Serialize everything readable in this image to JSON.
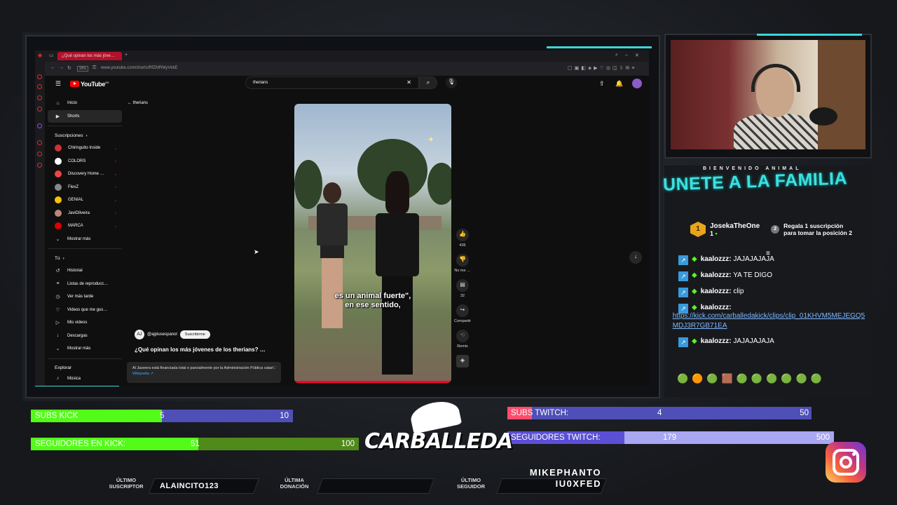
{
  "browser": {
    "tab_title": "¿Qué opinan los más jóve…",
    "zoom": "33%",
    "url": "www.youtube.com/shorts/RfZMRMyVkkE"
  },
  "youtube": {
    "logo": "YouTube",
    "logo_sup": "MX",
    "search_value": "therians",
    "back_label": "therians",
    "nav_main": [
      {
        "icon": "home-icon",
        "glyph": "⌂",
        "label": "Inicio"
      },
      {
        "icon": "shorts-icon",
        "glyph": "▶",
        "label": "Shorts"
      }
    ],
    "subs_header": "Suscripciones",
    "subscriptions": [
      {
        "label": "Chiringuito Inside",
        "color": "#c33"
      },
      {
        "label": "COLORS",
        "color": "#fff"
      },
      {
        "label": "Discovery Home …",
        "color": "#e44"
      },
      {
        "label": "FlexZ",
        "color": "#888"
      },
      {
        "label": "GENIAL",
        "color": "#f4c20d"
      },
      {
        "label": "JaviOliveira",
        "color": "#b87"
      },
      {
        "label": "MARCA",
        "color": "#d00"
      }
    ],
    "show_more": "Mostrar más",
    "you_header": "Tú",
    "you_items": [
      {
        "glyph": "↺",
        "label": "Historial"
      },
      {
        "glyph": "≡",
        "label": "Listas de reproducc…"
      },
      {
        "glyph": "◷",
        "label": "Ver más tarde"
      },
      {
        "glyph": "♡",
        "label": "Videos que me gus…"
      },
      {
        "glyph": "▷",
        "label": "Mis videos"
      },
      {
        "glyph": "↓",
        "label": "Descargas"
      },
      {
        "glyph": "⌄",
        "label": "Mostrar más"
      }
    ],
    "explore_header": "Explorar",
    "explore_item": "Música",
    "short": {
      "caption_line1": "es un animal fuerte\",",
      "caption_line2": "en ese sentido,",
      "channel": "@ajplusespanol",
      "subscribe": "Suscribirme",
      "title": "¿Qué opinan los más jóvenes de los therians? …",
      "info_text": "Al Jazeera está financiada total o parcialmente por la Administración Pública catarí.",
      "info_link": "Wikipedia ↗",
      "likes": "436",
      "dislike": "No me …",
      "comments": "32",
      "share": "Compartir",
      "remix": "Remix"
    }
  },
  "overlay": {
    "welcome": "BIENVENIDO ANIMAL",
    "join": "UNETE A LA FAMILIA",
    "leader_name": "JosekaTheOne",
    "leader_count": "1",
    "gift_text": "Regala 1 suscripción para tomar la posición 2",
    "chat": [
      {
        "user": "kaalozzz:",
        "msg": "JAJAJAJAJA"
      },
      {
        "user": "kaalozzz:",
        "msg": "YA TE DIGO"
      },
      {
        "user": "kaalozzz:",
        "msg": "clip"
      },
      {
        "user": "kaalozzz:",
        "msg": "",
        "link": "https://kick.com/carballedakick/clips/clip_01KHVM5MEJEGQ5MDJ3R7GB71EA"
      },
      {
        "user": "kaalozzz:",
        "msg": "JAJAJAJAJA"
      }
    ],
    "emotes": "🟢🟠🟢🟫🟢🟢🟢🟢🟢🟢",
    "bars": {
      "subs_kick": {
        "label": "SUBS KICK",
        "current": "5",
        "goal": "10",
        "progress": 0.5
      },
      "seg_kick": {
        "label": "SEGUIDORES EN KICK:",
        "current": "51",
        "goal": "100",
        "progress": 0.51
      },
      "subs_twitch": {
        "label": "SUBS TWITCH:",
        "current": "4",
        "goal": "50",
        "progress": 0.08
      },
      "seg_twitch": {
        "label": "SEGUIDORES TWITCH:",
        "current": "179",
        "goal": "500",
        "progress": 0.358
      }
    },
    "logo_text": "CARBALLEDA",
    "last_sub_label": "ÚLTIMO SUSCRIPTOR",
    "last_sub": "ALAINCITO123",
    "last_don_label": "ÚLTIMA DONACIÓN",
    "last_don": "",
    "last_follow_label": "ÚLTIMO SEGUIDOR",
    "last_follow": "MIKEPHANTO IU0XFED"
  },
  "colors": {
    "accent": "#3ad6d6",
    "kick_green": "#53fc18",
    "twitch_purple": "#6a5acd",
    "yt_red": "#ff0000"
  }
}
